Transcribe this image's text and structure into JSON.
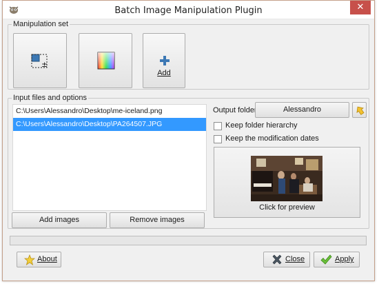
{
  "window": {
    "title": "Batch Image Manipulation Plugin"
  },
  "manipulation_set": {
    "label": "Manipulation set",
    "tools": [
      {
        "name": "resize-icon"
      },
      {
        "name": "color-palette-icon"
      },
      {
        "name": "add-icon",
        "label": "Add"
      }
    ]
  },
  "input": {
    "label": "Input files and options",
    "files": [
      "C:\\Users\\Alessandro\\Desktop\\me-iceland.png",
      "C:\\Users\\Alessandro\\Desktop\\PA264507.JPG"
    ],
    "selected_index": 1,
    "add_images_label": "Add images",
    "remove_images_label": "Remove images",
    "output_folder_label": "Output folder",
    "output_folder_value": "Alessandro",
    "keep_hierarchy_label": "Keep folder hierarchy",
    "keep_hierarchy_checked": false,
    "keep_dates_label": "Keep the modification dates",
    "keep_dates_checked": false,
    "preview_caption": "Click for preview"
  },
  "progress": {
    "fraction": 0
  },
  "footer": {
    "about_label": "About",
    "close_label": "Close",
    "apply_label": "Apply"
  },
  "colors": {
    "selection": "#3399ff",
    "close_button": "#c7504a",
    "add_plus": "#3c78b4"
  }
}
